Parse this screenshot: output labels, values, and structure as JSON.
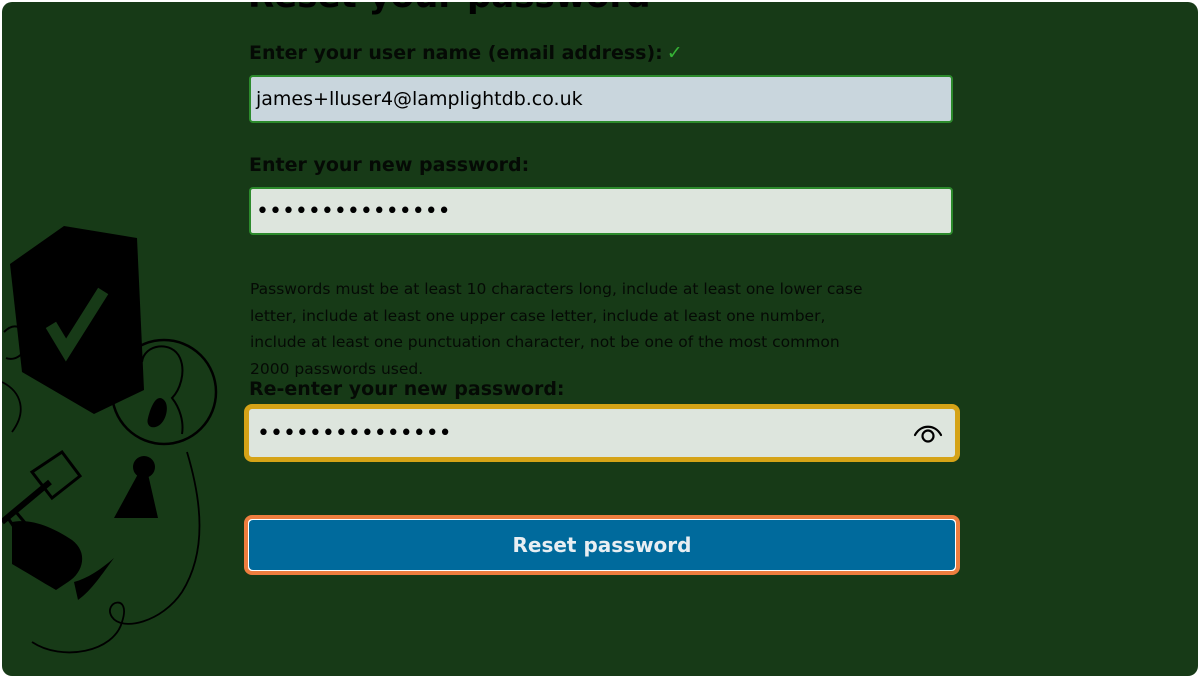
{
  "page": {
    "title": "Reset your password"
  },
  "form": {
    "username_label": "Enter your user name (email address):",
    "username_valid_mark": "✓",
    "username_value": "james+lluser4@lamplightdb.co.uk",
    "new_password_label": "Enter your new password:",
    "new_password_masked": "•••••••••••••••",
    "password_rules": "Passwords must be at least 10 characters long, include at least one lower case letter, include at least one upper case letter, include at least one number, include at least one punctuation character, not be one of the most common 2000 passwords used.",
    "reenter_label": "Re-enter your new password:",
    "reenter_masked": "•••••••••••••••",
    "show_password_icon": "eye-icon",
    "submit_label": "Reset password"
  },
  "colors": {
    "background": "#173a17",
    "field_border": "#2c8a2c",
    "focus_ring": "#d5a317",
    "button": "#006a9c",
    "button_focus_ring": "#ee7d3f",
    "valid_check": "#36b336"
  }
}
